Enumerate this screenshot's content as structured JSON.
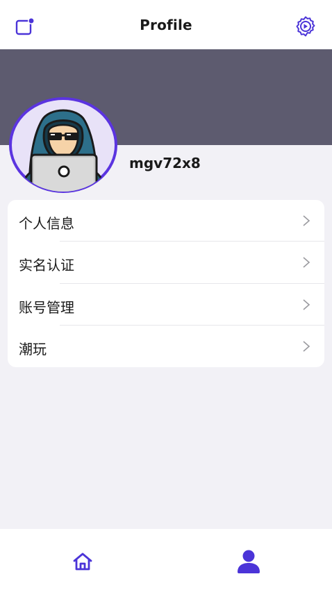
{
  "header": {
    "title": "Profile",
    "left_icon": "note-add-icon",
    "right_icon": "settings-icon"
  },
  "profile": {
    "username": "mgv72x8",
    "avatar": "hacker-avatar"
  },
  "menu": {
    "items": [
      {
        "label": "个人信息"
      },
      {
        "label": "实名认证"
      },
      {
        "label": "账号管理"
      },
      {
        "label": "潮玩"
      }
    ]
  },
  "tabbar": {
    "tabs": [
      {
        "name": "home",
        "icon": "home-icon",
        "active": false
      },
      {
        "name": "profile",
        "icon": "user-icon",
        "active": true
      }
    ]
  },
  "colors": {
    "accent": "#4b34d8",
    "banner": "#5d5b6f",
    "background": "#f2f1f6",
    "card": "#ffffff"
  }
}
